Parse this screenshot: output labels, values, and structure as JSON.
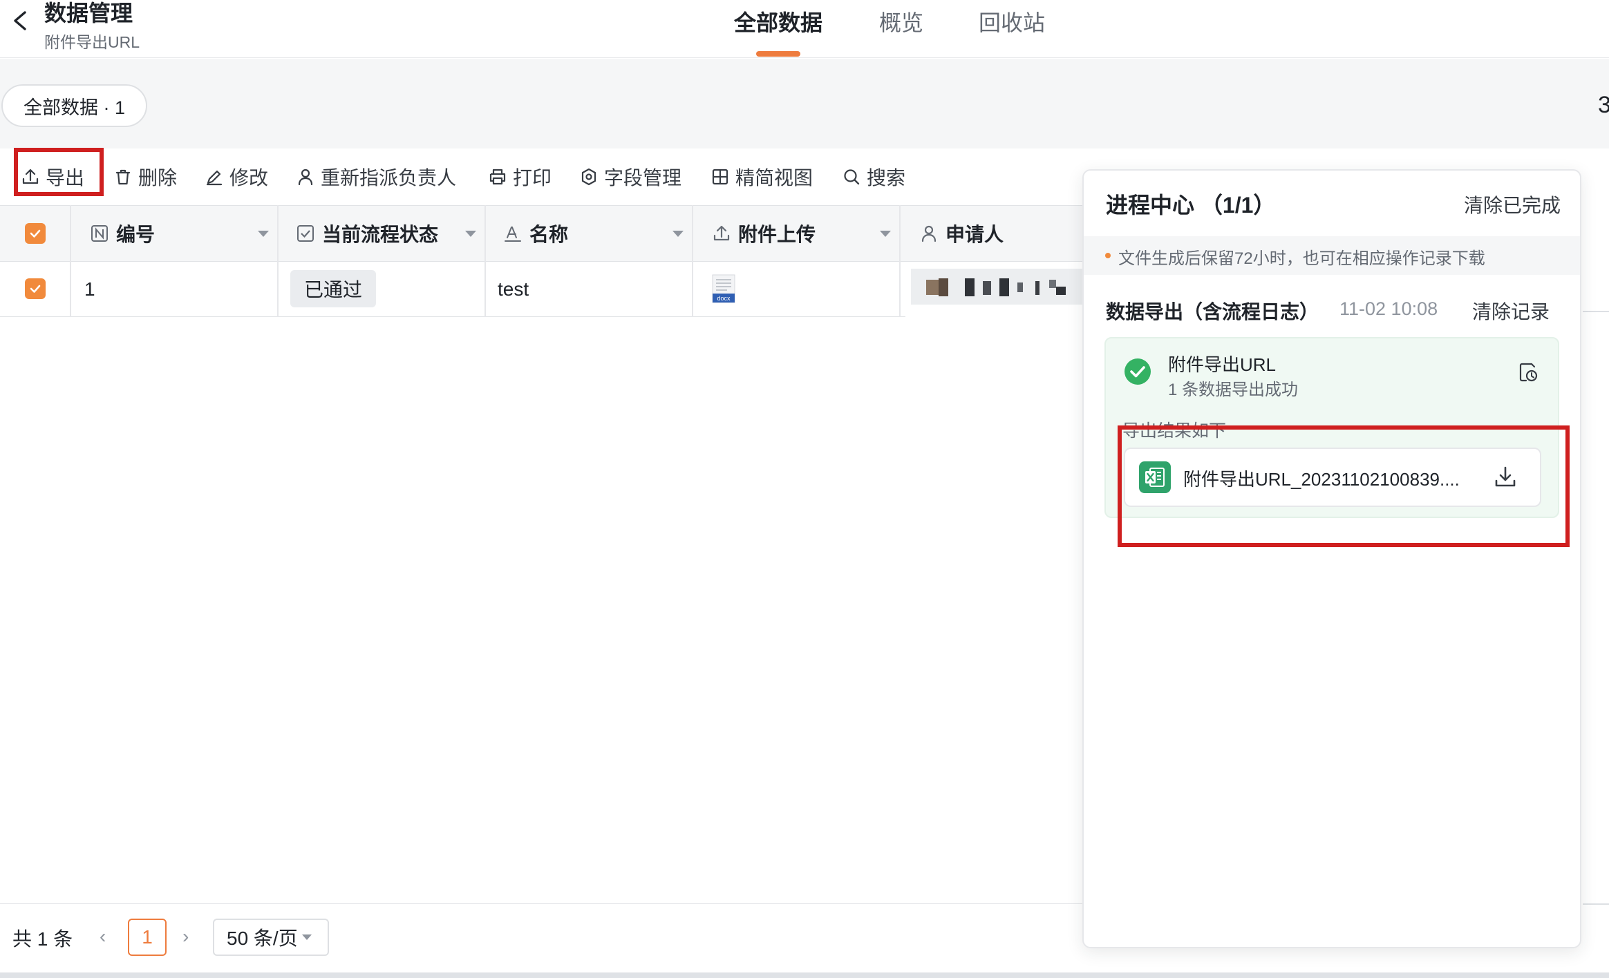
{
  "header": {
    "title": "数据管理",
    "subtitle": "附件导出URL",
    "tabs": [
      "全部数据",
      "概览",
      "回收站"
    ],
    "active_tab": 0,
    "accent_color": "#ee7c3e"
  },
  "view": {
    "pill_label": "全部数据 · 1",
    "edge_text": "3"
  },
  "toolbar": {
    "export": "导出",
    "delete": "删除",
    "edit": "修改",
    "reassign": "重新指派负责人",
    "print": "打印",
    "fields": "字段管理",
    "compact_view": "精简视图",
    "search": "搜索"
  },
  "table": {
    "columns": [
      "编号",
      "当前流程状态",
      "名称",
      "附件上传",
      "申请人"
    ],
    "rows": [
      {
        "id": "1",
        "status": "已通过",
        "name": "test",
        "attachment_type": "docx",
        "applicant": ""
      }
    ]
  },
  "footer": {
    "total": "共 1 条",
    "current_page": "1",
    "page_size": "50 条/页"
  },
  "panel": {
    "title": "进程中心 （1/1）",
    "clear_all": "清除已完成",
    "notice": "文件生成后保留72小时，也可在相应操作记录下载",
    "job_title": "数据导出（含流程日志）",
    "job_time": "11-02 10:08",
    "clear_record": "清除记录",
    "card_name": "附件导出URL",
    "card_status": "1 条数据导出成功",
    "result_label": "导出结果如下",
    "file_name": "附件导出URL_20231102100839....",
    "success_color": "#34b263",
    "excel_color": "#2fa36b"
  }
}
